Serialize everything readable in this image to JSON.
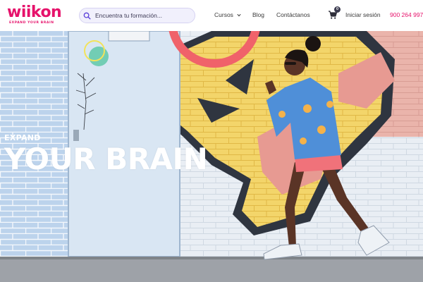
{
  "brand": {
    "name": "wiikon",
    "tagline": "EXPAND YOUR BRAIN",
    "accent_color": "#e6126b"
  },
  "search": {
    "placeholder": "Encuentra tu formación...",
    "icon": "search-icon"
  },
  "nav": {
    "courses_label": "Cursos",
    "courses_icon": "chevron-down-icon",
    "blog_label": "Blog",
    "contact_label": "Contáctanos",
    "cart_icon": "cart-icon",
    "cart_count": "0",
    "login_label": "Iniciar sesión",
    "phone": "900 264 997"
  },
  "hero": {
    "kicker": "EXPAND",
    "title": "YOUR BRAIN",
    "image_description_icon": "hero-photo"
  }
}
